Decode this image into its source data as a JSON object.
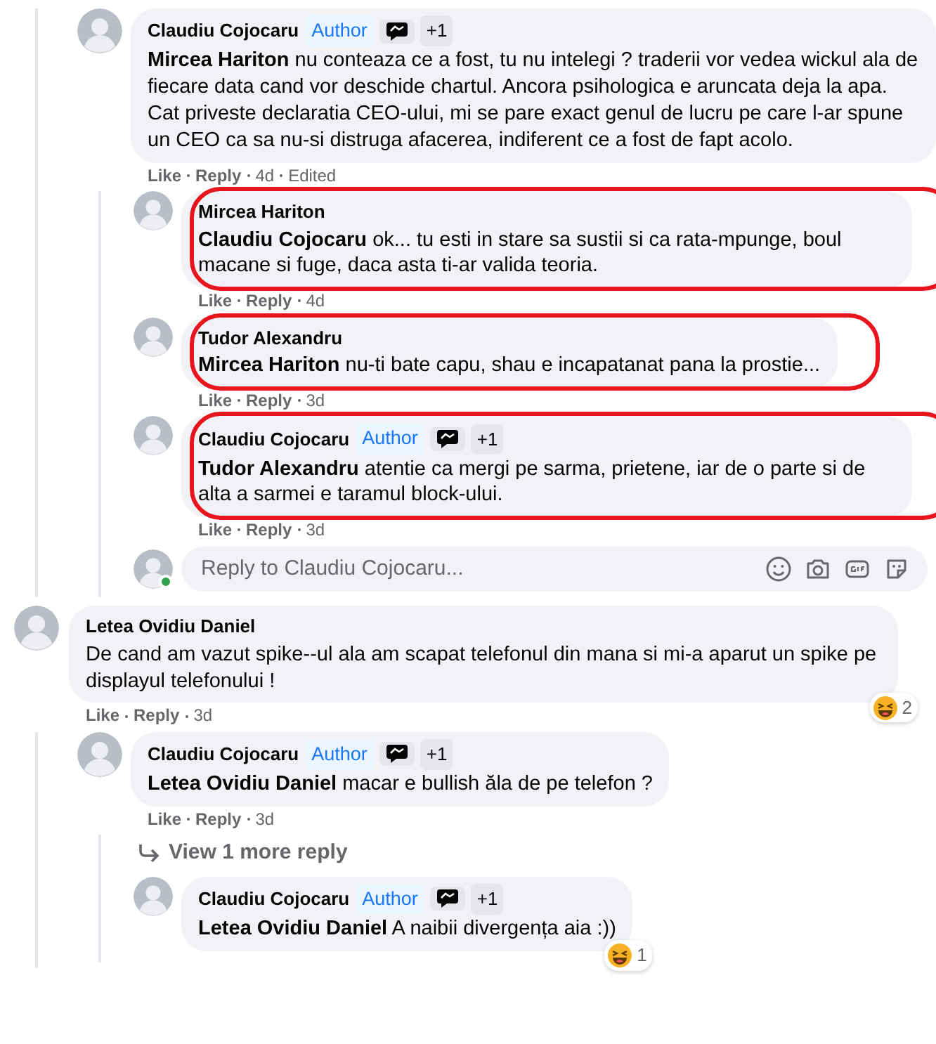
{
  "threads": [
    {
      "kind": "continued",
      "children": [
        {
          "author": "Claudiu Cojocaru",
          "author_label": "Author",
          "badge_count": "+1",
          "text": "**Mircea Hariton** nu conteaza ce a fost, tu nu intelegi ? traderii vor vedea wickul ala de fiecare data cand vor deschide chartul. Ancora psihologica e aruncata deja la apa.\nCat priveste declaratia CEO-ului, mi se pare exact genul de lucru pe care l-ar spune un CEO ca sa nu-si distruga afacerea, indiferent ce a fost de fapt acolo.",
          "like": "Like",
          "reply": "Reply",
          "time": "4d",
          "edited": "Edited",
          "highlighted": false,
          "children": [
            {
              "author": "Mircea Hariton",
              "text": "**Claudiu Cojocaru** ok... tu esti in stare sa sustii si ca rata-mpunge, boul macane si fuge, daca asta ti-ar valida teoria.",
              "like": "Like",
              "reply": "Reply",
              "time": "4d",
              "highlighted": true
            },
            {
              "author": "Tudor Alexandru",
              "text": "**Mircea Hariton** nu-ti bate capu, shau e incapatanat pana la prostie...",
              "like": "Like",
              "reply": "Reply",
              "time": "3d",
              "highlighted": true
            },
            {
              "author": "Claudiu Cojocaru",
              "author_label": "Author",
              "badge_count": "+1",
              "text": "**Tudor Alexandru** atentie ca mergi pe sarma, prietene, iar de o parte si de alta a sarmei e taramul block-ului.",
              "like": "Like",
              "reply": "Reply",
              "time": "3d",
              "highlighted": true
            }
          ],
          "reply_box": {
            "placeholder": "Reply to Claudiu Cojocaru...",
            "online": true
          }
        }
      ]
    },
    {
      "kind": "comment",
      "author": "Letea Ovidiu Daniel",
      "text": "De cand am vazut spike--ul ala am scapat telefonul din mana si mi-a aparut un spike pe displayul telefonului !",
      "like": "Like",
      "reply": "Reply",
      "time": "3d",
      "highlighted": false,
      "reaction_count": "2",
      "children": [
        {
          "author": "Claudiu Cojocaru",
          "author_label": "Author",
          "badge_count": "+1",
          "text": "**Letea Ovidiu Daniel** macar e bullish ăla de pe telefon ?",
          "like": "Like",
          "reply": "Reply",
          "time": "3d",
          "highlighted": false,
          "more_replies": "View 1 more reply",
          "children": [
            {
              "author": "Claudiu Cojocaru",
              "author_label": "Author",
              "badge_count": "+1",
              "text": "**Letea Ovidiu Daniel** A naibii divergența aia :))",
              "highlighted": false,
              "reaction_count": "1"
            }
          ]
        }
      ]
    }
  ]
}
